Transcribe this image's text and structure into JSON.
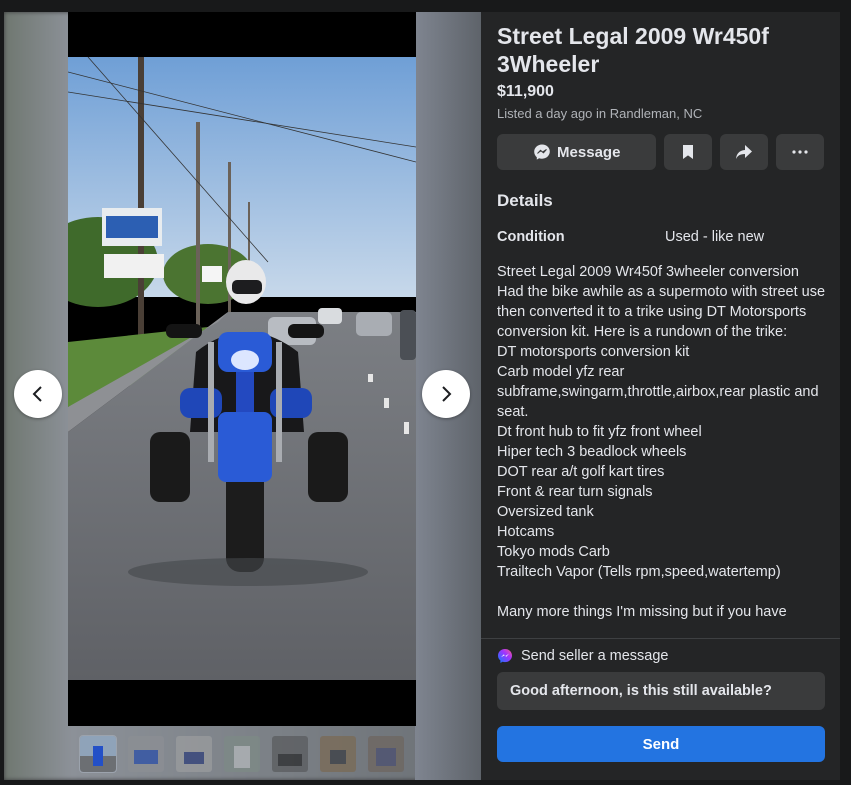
{
  "listing": {
    "title": "Street Legal 2009 Wr450f 3Wheeler",
    "price": "$11,900",
    "listed": "Listed a day ago in Randleman, NC"
  },
  "actions": {
    "message_label": "Message",
    "icons": [
      "messenger-icon",
      "bookmark-icon",
      "share-icon",
      "more-icon"
    ]
  },
  "details": {
    "heading": "Details",
    "condition_label": "Condition",
    "condition_value": "Used - like new",
    "description": [
      "Street Legal 2009 Wr450f 3wheeler conversion",
      "Had the bike awhile as a supermoto with street use then converted it to a trike using DT Motorsports conversion kit. Here is a rundown of the trike:",
      "DT motorsports conversion kit",
      "Carb model yfz rear subframe,swingarm,throttle,airbox,rear plastic and seat.",
      "Dt front hub to fit yfz front wheel",
      "Hiper tech 3 beadlock wheels",
      "DOT rear a/t golf kart tires",
      "Front & rear turn signals",
      "Oversized tank",
      "Hotcams",
      "Tokyo mods Carb",
      "Trailtech Vapor (Tells rpm,speed,watertemp)",
      "",
      "Many more things I'm missing but if you have"
    ]
  },
  "seller_message": {
    "heading": "Send seller a message",
    "message_value": "Good afternoon, is this still available?",
    "send_label": "Send"
  },
  "gallery": {
    "thumbnail_count": 7,
    "active_index": 0
  },
  "colors": {
    "background": "#18191a",
    "panel": "#242526",
    "button": "#3a3b3c",
    "accent": "#2374e1",
    "text": "#e4e6eb",
    "secondary_text": "#b0b3b8"
  }
}
